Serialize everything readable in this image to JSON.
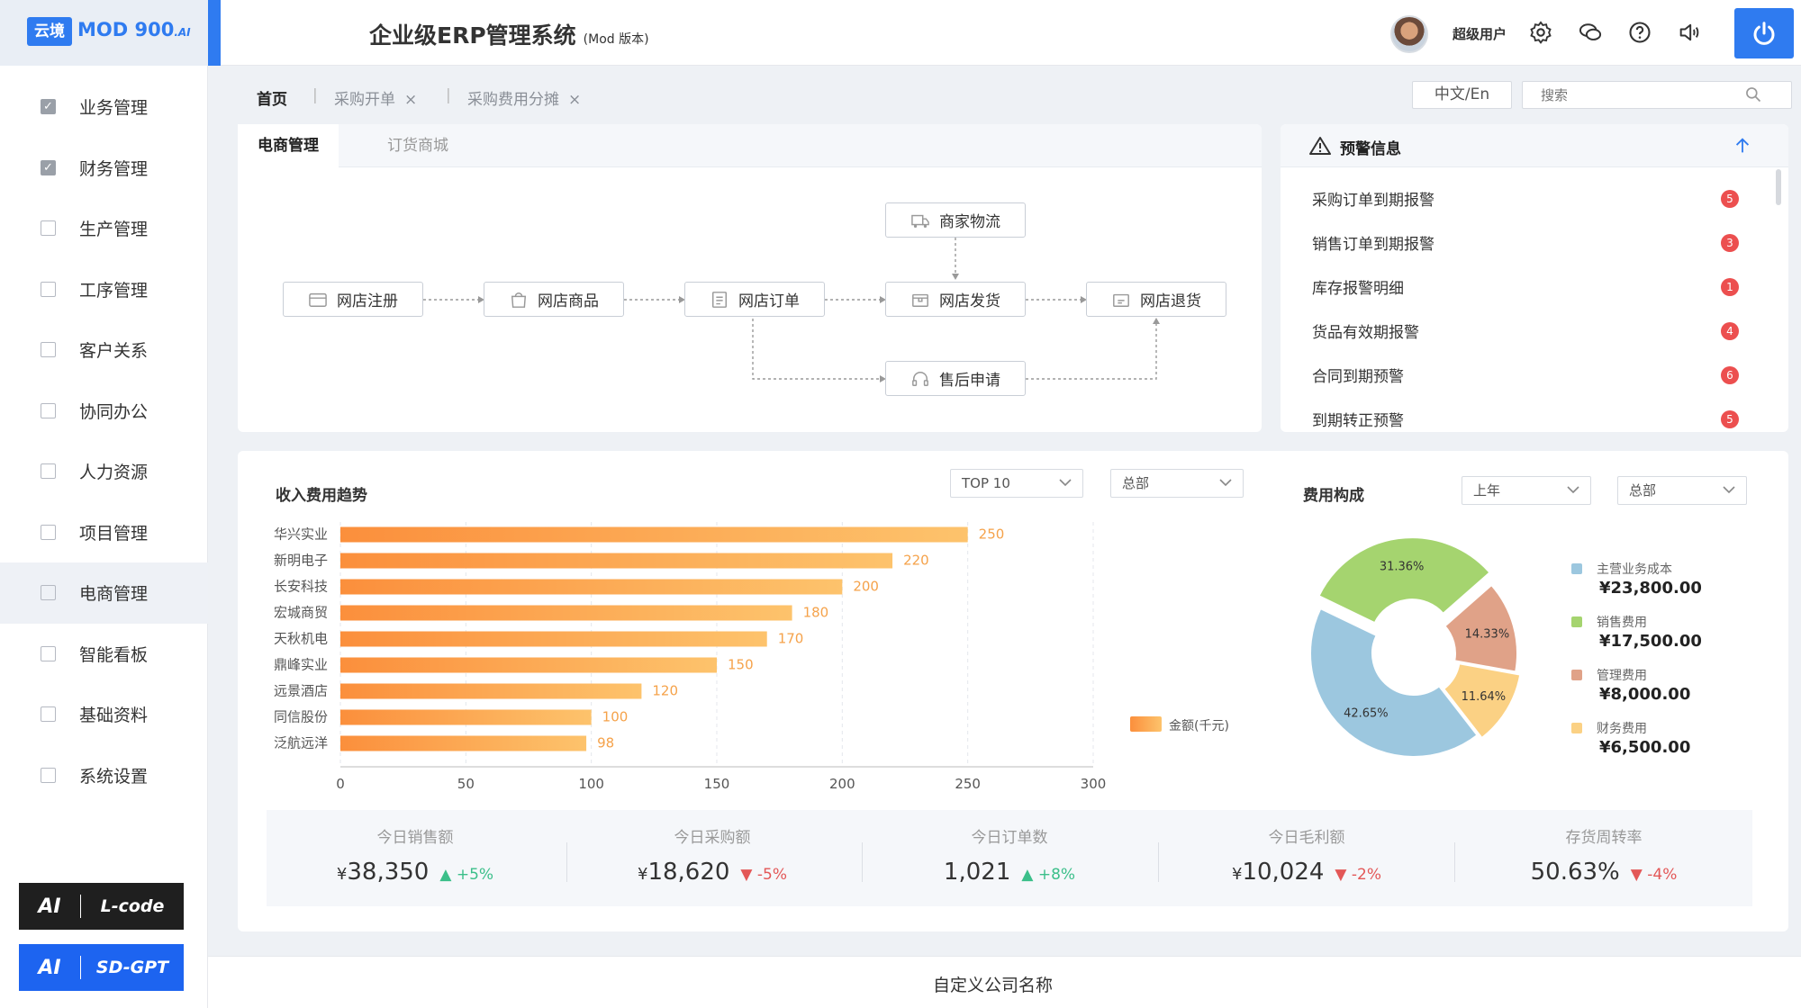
{
  "logo": {
    "badge": "云境",
    "name": "MOD 900",
    "suffix": ".AI"
  },
  "header": {
    "title": "企业级ERP管理系统",
    "subtitle": "(Mod 版本)",
    "user": "超级用户"
  },
  "sidebar": {
    "items": [
      {
        "label": "业务管理",
        "checked": true
      },
      {
        "label": "财务管理",
        "checked": true
      },
      {
        "label": "生产管理",
        "checked": false
      },
      {
        "label": "工序管理",
        "checked": false
      },
      {
        "label": "客户关系",
        "checked": false
      },
      {
        "label": "协同办公",
        "checked": false
      },
      {
        "label": "人力资源",
        "checked": false
      },
      {
        "label": "项目管理",
        "checked": false
      },
      {
        "label": "电商管理",
        "checked": false,
        "active": true
      },
      {
        "label": "智能看板",
        "checked": false
      },
      {
        "label": "基础资料",
        "checked": false
      },
      {
        "label": "系统设置",
        "checked": false
      }
    ],
    "ai_buttons": [
      {
        "ai": "AI",
        "label": "L-code",
        "color": "#1f1f1f"
      },
      {
        "ai": "AI",
        "label": "SD-GPT",
        "color": "#1d64f0"
      }
    ]
  },
  "tabs": {
    "home": "首页",
    "items": [
      "采购开单",
      "采购费用分摊"
    ]
  },
  "lang": "中文/En",
  "search": {
    "placeholder": "搜索"
  },
  "flow": {
    "tabs": [
      "电商管理",
      "订货商城"
    ],
    "nodes": {
      "register": "网店注册",
      "goods": "网店商品",
      "order": "网店订单",
      "logistics": "商家物流",
      "ship": "网店发货",
      "refund": "网店退货",
      "aftersale": "售后申请"
    }
  },
  "alerts": {
    "title": "预警信息",
    "items": [
      {
        "label": "采购订单到期报警",
        "count": "5"
      },
      {
        "label": "销售订单到期报警",
        "count": "3"
      },
      {
        "label": "库存报警明细",
        "count": "1"
      },
      {
        "label": "货品有效期报警",
        "count": "4"
      },
      {
        "label": "合同到期预警",
        "count": "6"
      },
      {
        "label": "到期转正预警",
        "count": "5"
      }
    ]
  },
  "revenue": {
    "title": "收入费用趋势",
    "dropdown1": "TOP 10",
    "dropdown2": "总部",
    "legend": "金额(千元)"
  },
  "cost": {
    "title": "费用构成",
    "dropdown1": "上年",
    "dropdown2": "总部"
  },
  "chart_data": [
    {
      "type": "bar",
      "orientation": "horizontal",
      "title": "收入费用趋势",
      "categories": [
        "华兴实业",
        "新明电子",
        "长安科技",
        "宏城商贸",
        "天秋机电",
        "鼎峰实业",
        "远景酒店",
        "同信股份",
        "泛航远洋"
      ],
      "series": [
        {
          "name": "金额(千元)",
          "values": [
            250,
            220,
            200,
            180,
            170,
            150,
            120,
            100,
            98
          ]
        }
      ],
      "xticks": [
        0,
        50,
        100,
        150,
        200,
        250,
        300
      ],
      "xlim": [
        0,
        300
      ],
      "grid": true,
      "legend": "right"
    },
    {
      "type": "pie",
      "title": "费用构成",
      "labels": [
        "主营业务成本",
        "销售费用",
        "管理费用",
        "财务费用"
      ],
      "values": [
        23800,
        17500,
        8000,
        6500
      ],
      "percent_labels": [
        "42.65%",
        "31.36%",
        "14.33%",
        "11.64%"
      ],
      "amount_labels": [
        "¥23,800.00",
        "¥17,500.00",
        "¥8,000.00",
        "¥6,500.00"
      ],
      "colors": [
        "#9cc7df",
        "#a5d46f",
        "#e0a288",
        "#fbd184"
      ],
      "donut": true,
      "legend": "right"
    }
  ],
  "stats": [
    {
      "label": "今日销售额",
      "currency": "¥",
      "value": "38,350",
      "change": "+5%",
      "dir": "up"
    },
    {
      "label": "今日采购额",
      "currency": "¥",
      "value": "18,620",
      "change": "-5%",
      "dir": "down"
    },
    {
      "label": "今日订单数",
      "currency": "",
      "value": "1,021",
      "change": "+8%",
      "dir": "up"
    },
    {
      "label": "今日毛利额",
      "currency": "¥",
      "value": "10,024",
      "change": "-2%",
      "dir": "down"
    },
    {
      "label": "存货周转率",
      "currency": "",
      "value": "50.63%",
      "change": "-4%",
      "dir": "down"
    }
  ],
  "footer": "自定义公司名称",
  "colors": {
    "accent": "#2f7bf0",
    "bar_start": "#fb8f3c",
    "bar_end": "#fdc36c",
    "alert_badge": "#ec4f4f"
  }
}
